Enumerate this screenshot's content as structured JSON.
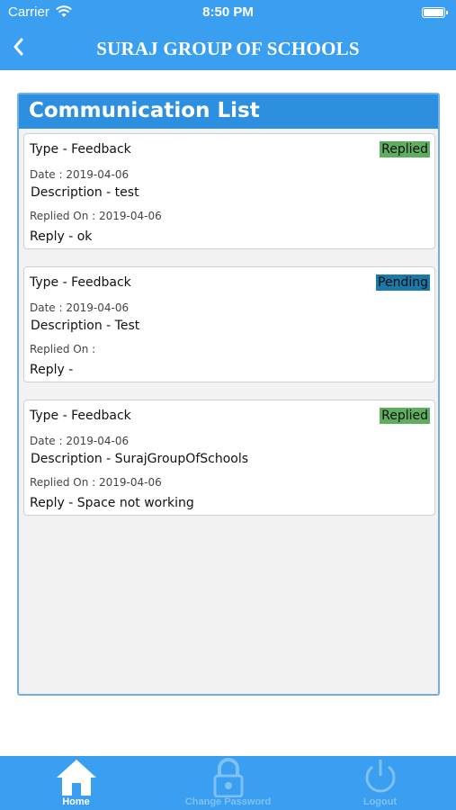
{
  "status_bar": {
    "carrier": "Carrier",
    "time": "8:50 PM"
  },
  "header": {
    "title": "SURAJ GROUP OF SCHOOLS",
    "back_icon": "chevron-left-icon"
  },
  "panel": {
    "title": "Communication List"
  },
  "items": [
    {
      "type": "Type - Feedback",
      "status": "Replied",
      "status_color": "#5fae5f",
      "date": "Date : 2019-04-06",
      "description": "Description - test",
      "replied_on": "Replied On : 2019-04-06",
      "reply": "Reply - ok"
    },
    {
      "type": "Type - Feedback",
      "status": "Pending",
      "status_color": "#1b78a8",
      "date": "Date : 2019-04-06",
      "description": "Description - Test",
      "replied_on": "Replied On :",
      "reply": "Reply -"
    },
    {
      "type": "Type - Feedback",
      "status": "Replied",
      "status_color": "#5fae5f",
      "date": "Date : 2019-04-06",
      "description": "Description - SurajGroupOfSchools",
      "replied_on": "Replied On : 2019-04-06",
      "reply": "Reply - Space not working"
    }
  ],
  "tabs": [
    {
      "label": "Home",
      "icon": "home-icon",
      "active": true
    },
    {
      "label": "Change Password",
      "icon": "lock-icon",
      "active": false
    },
    {
      "label": "Logout",
      "icon": "power-icon",
      "active": false
    }
  ],
  "colors": {
    "primary": "#3a9ff0",
    "panel_header": "#2d8fe0",
    "replied": "#5fae5f",
    "pending": "#1b78a8"
  }
}
